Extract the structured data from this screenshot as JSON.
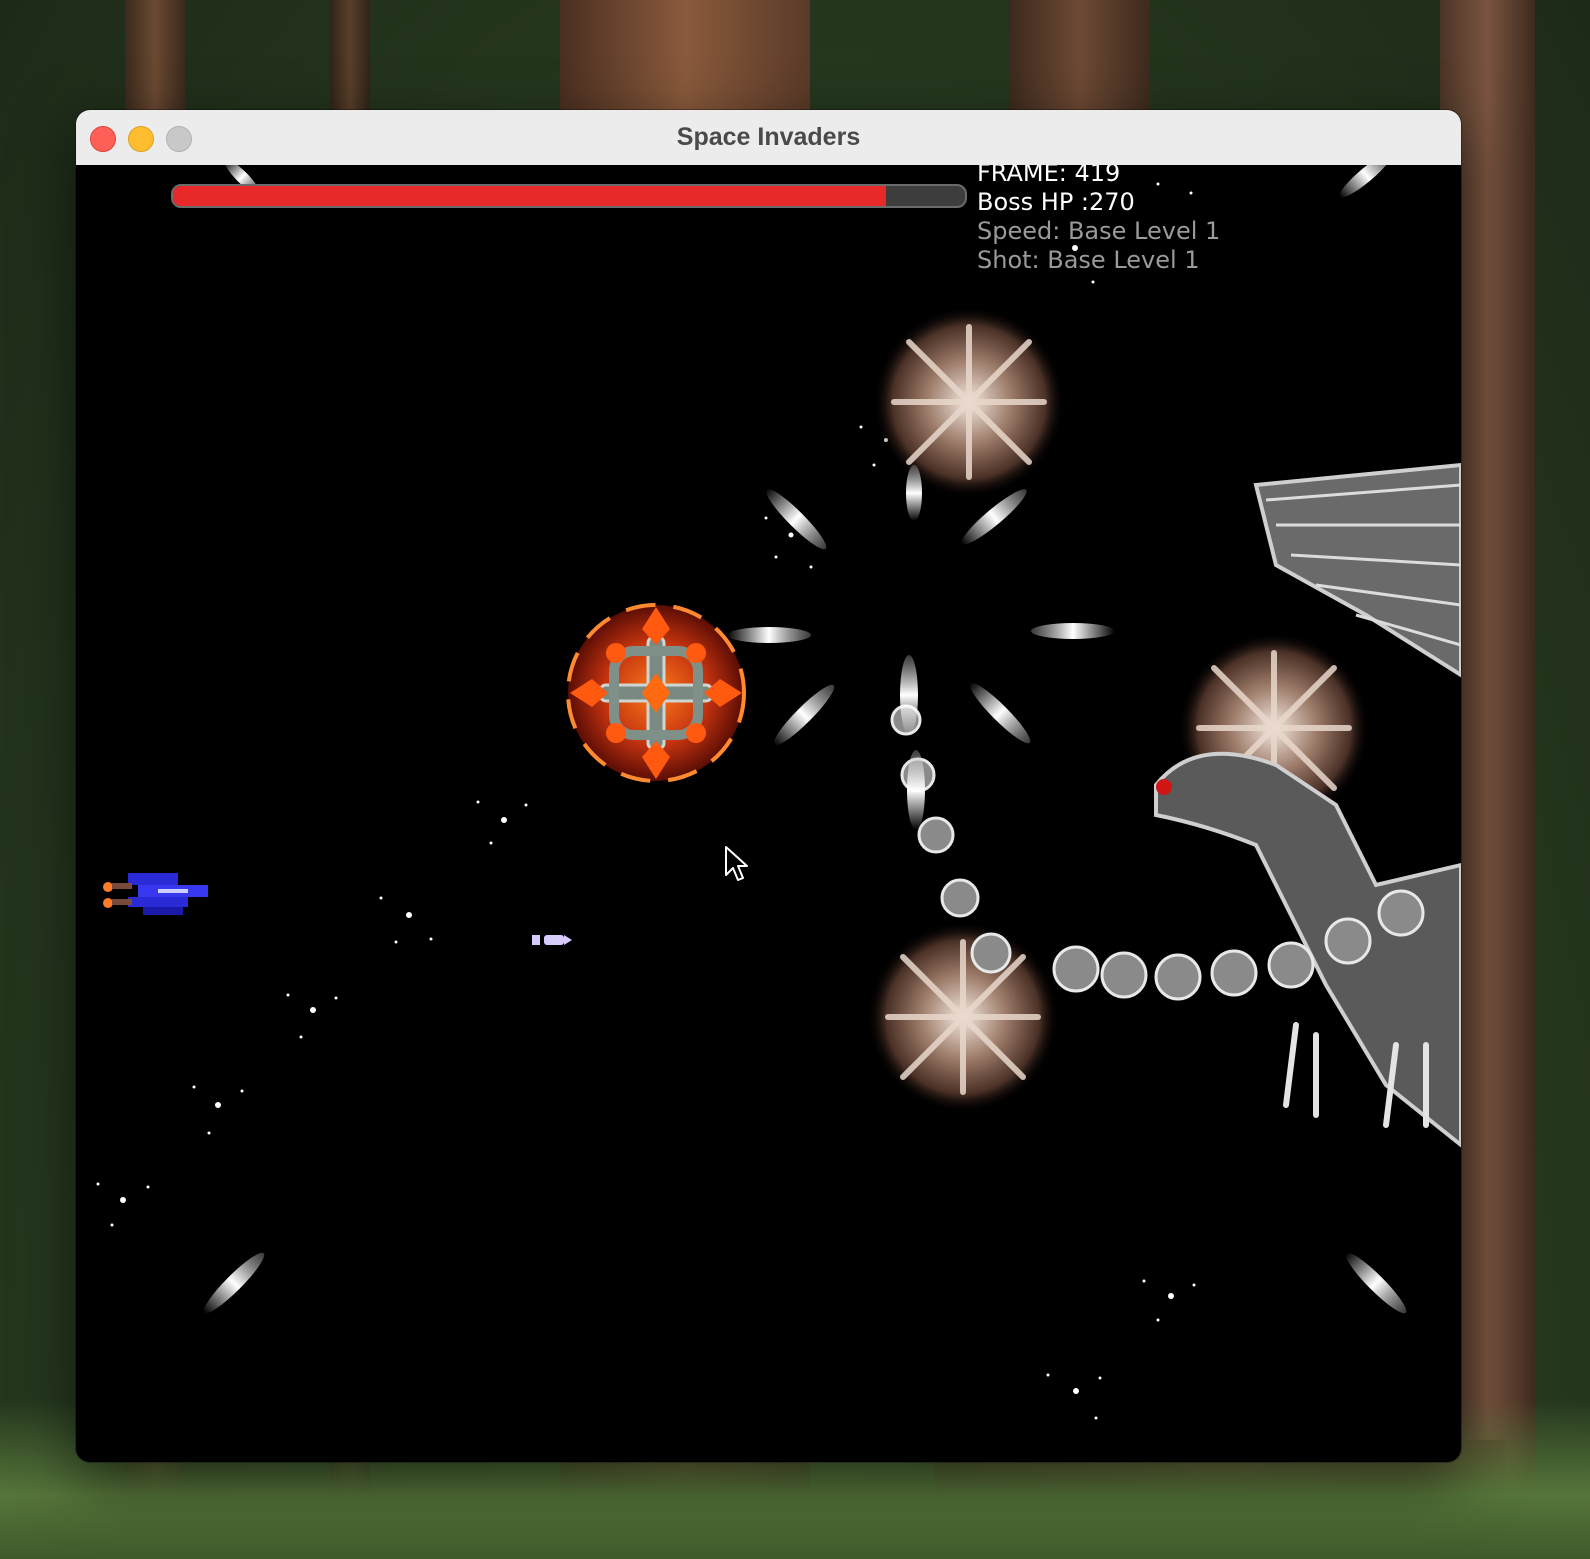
{
  "window": {
    "title": "Space Invaders",
    "buttons": [
      "close",
      "minimize",
      "zoom"
    ]
  },
  "hud": {
    "frame_label": "FRAME: 419",
    "boss_hp_label": "Boss HP :270",
    "speed_label": "Speed: Base Level 1",
    "shot_label": "Shot: Base Level 1",
    "boss_hp_fraction": 0.9
  },
  "colors": {
    "hp_bar": "#e8292a",
    "player_ship": "#2a2ad6",
    "background": "#000000"
  },
  "sprites": {
    "player": "player-ship-icon",
    "player_bullet": "player-bullet-icon",
    "boss": "dragon-boss-icon",
    "spiked_mine": "spiked-mine-icon",
    "fire_orb": "fire-orb-icon",
    "enemy_projectile": "blade-projectile-icon"
  }
}
